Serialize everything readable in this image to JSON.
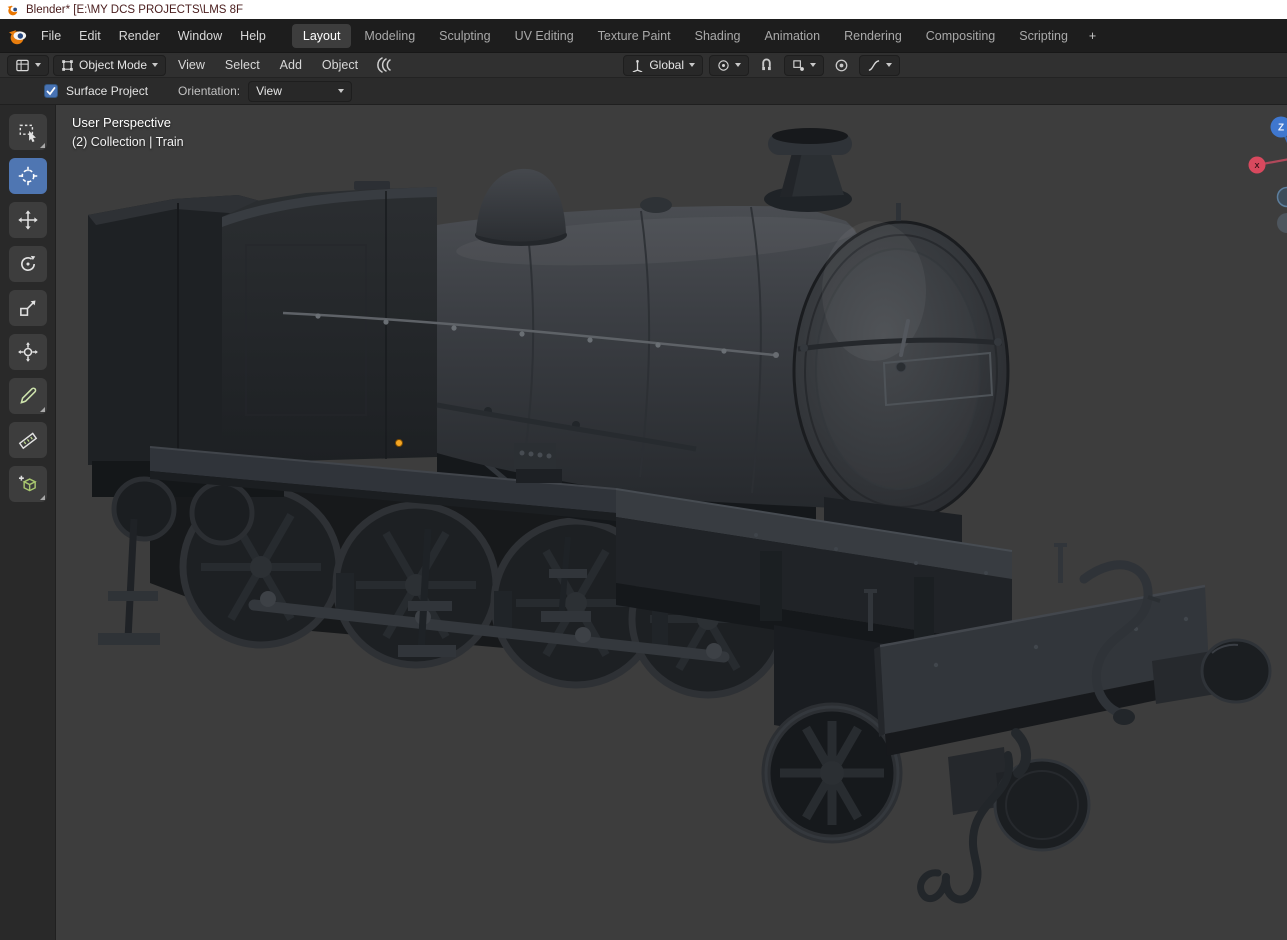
{
  "window": {
    "title": "Blender* [E:\\MY DCS PROJECTS\\LMS 8F"
  },
  "topbar": {
    "menus": [
      {
        "label": "File"
      },
      {
        "label": "Edit"
      },
      {
        "label": "Render"
      },
      {
        "label": "Window"
      },
      {
        "label": "Help"
      }
    ],
    "workspaces": [
      {
        "label": "Layout",
        "active": true
      },
      {
        "label": "Modeling"
      },
      {
        "label": "Sculpting"
      },
      {
        "label": "UV Editing"
      },
      {
        "label": "Texture Paint"
      },
      {
        "label": "Shading"
      },
      {
        "label": "Animation"
      },
      {
        "label": "Rendering"
      },
      {
        "label": "Compositing"
      },
      {
        "label": "Scripting"
      }
    ],
    "add_workspace_label": "+"
  },
  "header": {
    "mode_label": "Object Mode",
    "menus": [
      {
        "label": "View"
      },
      {
        "label": "Select"
      },
      {
        "label": "Add"
      },
      {
        "label": "Object"
      }
    ],
    "orientation_label": "Global"
  },
  "tool_settings": {
    "surface_project_label": "Surface Project",
    "orientation_label": "Orientation:",
    "orientation_value": "View"
  },
  "toolbar": {
    "active_tool": "cursor",
    "tools": [
      "select-box",
      "cursor",
      "move",
      "rotate",
      "scale",
      "transform",
      "annotate",
      "measure",
      "add-cube"
    ]
  },
  "viewport": {
    "overlay": {
      "line1": "User Perspective",
      "line2": "(2) Collection | Train"
    },
    "scene_object": "steam-locomotive",
    "gizmo": {
      "z_label": "Z",
      "x_label": "X"
    }
  },
  "colors": {
    "active_tool_blue": "#4772b3",
    "viewport_background": "#3d3d3d",
    "axis_z_blue": "#3f77cf",
    "axis_x_red": "#d8495e",
    "origin_orange": "#f5a623"
  }
}
